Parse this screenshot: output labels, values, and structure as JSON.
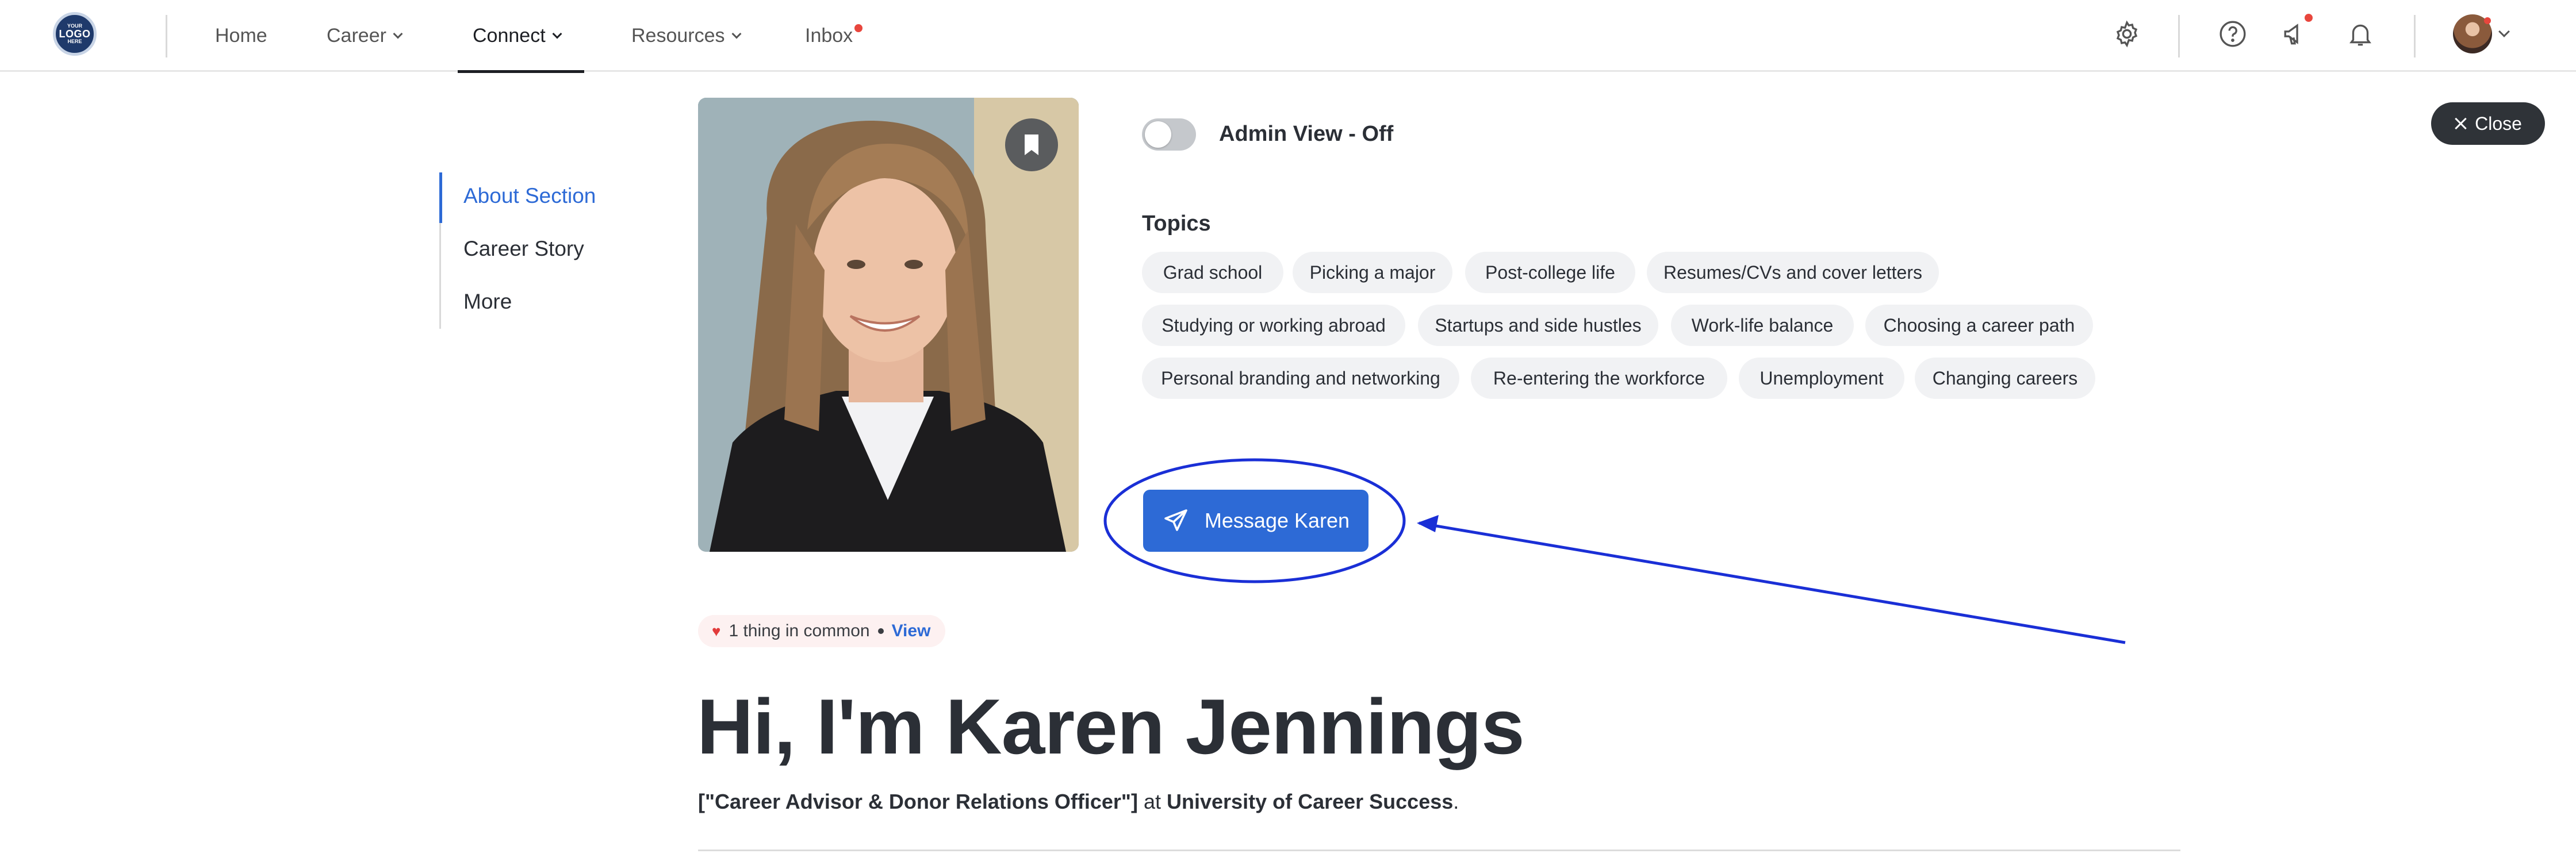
{
  "logo": {
    "line1": "YOUR",
    "line2": "LOGO",
    "line3": "HERE"
  },
  "nav": {
    "items": [
      {
        "label": "Home"
      },
      {
        "label": "Career"
      },
      {
        "label": "Connect"
      },
      {
        "label": "Resources"
      },
      {
        "label": "Inbox"
      }
    ],
    "active": "Connect"
  },
  "toolbar": {
    "icons": [
      "gear-icon",
      "help-icon",
      "megaphone-icon",
      "bell-icon",
      "avatar",
      "chevron-down-icon"
    ]
  },
  "close_button": {
    "label": "Close"
  },
  "section_nav": {
    "items": [
      {
        "label": "About Section"
      },
      {
        "label": "Career Story"
      },
      {
        "label": "More"
      }
    ],
    "active": "About Section"
  },
  "profile": {
    "admin_view_label": "Admin View - Off",
    "admin_view_on": false,
    "topics_title": "Topics",
    "topics": [
      "Grad school",
      "Picking a major",
      "Post-college life",
      "Resumes/CVs and cover letters",
      "Studying or working abroad",
      "Startups and side hustles",
      "Work-life balance",
      "Choosing a career path",
      "Personal branding and networking",
      "Re-entering the workforce",
      "Unemployment",
      "Changing careers"
    ],
    "message_button": "Message Karen",
    "common": {
      "text": "1 thing in common",
      "link": "View"
    },
    "heading": "Hi, I'm Karen Jennings",
    "title": "[\"Career Advisor & Donor Relations Officer\"]",
    "at": "at",
    "org": "University of Career Success",
    "period": "."
  },
  "colors": {
    "accent": "#2d6ad6",
    "annotation": "#1a2fd6",
    "notification": "#e8463d"
  }
}
